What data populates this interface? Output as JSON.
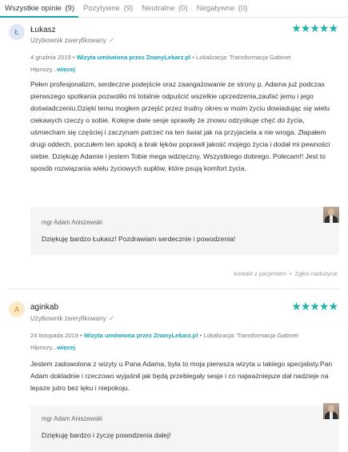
{
  "tabs": [
    {
      "label": "Wszystkie opinie",
      "count": "(9)"
    },
    {
      "label": "Pozytywne",
      "count": "(9)"
    },
    {
      "label": "Neutralne",
      "count": "(0)"
    },
    {
      "label": "Negatywne",
      "count": "(0)"
    }
  ],
  "reviews": [
    {
      "initial": "Ł",
      "avatar_bg": "#dfe7f4",
      "avatar_color": "#7b93c2",
      "author": "Łukasz",
      "verified": "Użytkownik zweryfikowany",
      "stars": "★★★★★",
      "date": "4 grudnia 2019",
      "visit": "Wizyta umówiona przez ZnanyLekarz.pl",
      "location": "Lokalizacja: Transformacja Gabinet",
      "location_cont": "Hipnozy...",
      "more": "więcej",
      "text": "Pełen profesjonalizm, serdeczne podejście oraz zaangażowanie ze strony p. Adama już podczas pierwszego spotkania pozwoliło mi totalnie odpuścić wszelkie uprzedzenia,zaufać jemu i jego doświadczeniu.Dzięki temu mogłem przejść przez trudny okres w moim życiu dowiadując się wielu ciekawych rzeczy o sobie. Kolejne dwie sesje sprawiły że znowu odzyskuje chęć do życia, uśmiecham się częściej i zaczynam patrzeć na ten świat jak na przyjaciela a nie wroga. Złapałem drugi oddech, poczułem ten spokój a brak lęków poprawił jakość mojego życia i dodał mi pewności siebie. Dziękuję Adamie i jestem Tobie mega wdzięczny. Wszystkiego dobrego. Polecam!! Jest to sposób rozwiązania wielu życiowych supłów, które psują komfort życia.",
      "reply_name": "mgr Adam Aniszewski",
      "reply_text": "Dziękuję bardzo Łukasz! Pozdrawiam serdecznie i powodzenia!",
      "footer_contact": "kontakt z pacjentem",
      "footer_report": "Zgłoś nadużycie"
    },
    {
      "initial": "A",
      "avatar_bg": "#fbe9c8",
      "avatar_color": "#d9a441",
      "author": "aginkab",
      "verified": "Użytkownik zweryfikowany",
      "stars": "★★★★★",
      "date": "24 listopada 2019",
      "visit": "Wizyta umówiona przez ZnanyLekarz.pl",
      "location": "Lokalizacja: Transformacja Gabinet",
      "location_cont": "Hipnozy...",
      "more": "więcej",
      "text": "Jestem zadowolona z wizyty u Pana Adama, była to moja pierwsza wizyta u takiego specjalisty.Pan Adam dokladnie i rzeczowo wyjaśnił jak będą przebiegały sesje i co najważniejsze dał nadzieje na lepsze jutro bez lęku i niepokoju.",
      "reply_name": "mgr Adam Aniszewski",
      "reply_text": "Dziękuję bardzo i życzę powodzenia dalej!"
    }
  ],
  "colors": {
    "accent": "#20b2aa",
    "link": "#17a2b8"
  },
  "icons": {
    "verified": "check-icon",
    "rating": "star-icon",
    "dot": "bullet-icon"
  }
}
